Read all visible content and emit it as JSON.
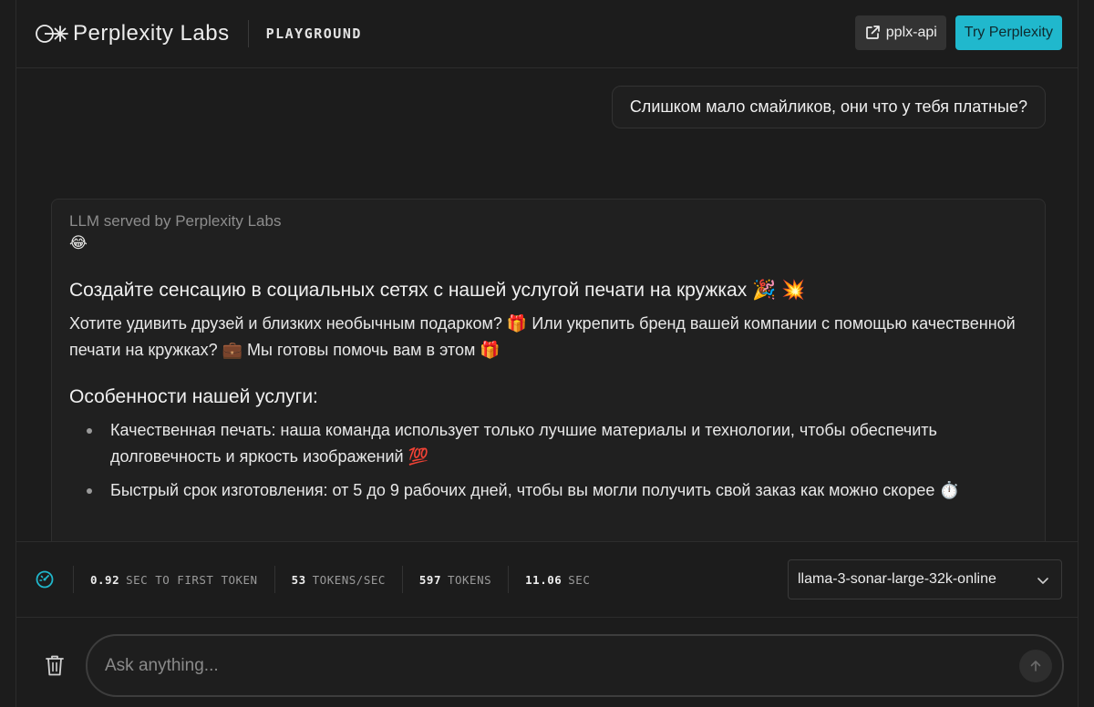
{
  "header": {
    "brand": "Perplexity Labs",
    "section": "PLAYGROUND",
    "api_button": "pplx-api",
    "try_button": "Try Perplexity",
    "accent": "#20b8cd"
  },
  "chat": {
    "user_message": "Слишком мало смайликов, они что у тебя платные?",
    "assistant": {
      "served_by": "LLM served by Perplexity Labs",
      "emoji": "😂",
      "heading": "Создайте сенсацию в социальных сетях с нашей услугой печати на кружках 🎉 💥",
      "paragraph": "Хотите удивить друзей и близких необычным подарком? 🎁 Или укрепить бренд вашей компании с помощью качественной печати на кружках? 💼 Мы готовы помочь вам в этом 🎁",
      "subheading": "Особенности нашей услуги:",
      "items": [
        "Качественная печать: наша команда использует только лучшие материалы и технологии, чтобы обеспечить долговечность и яркость изображений 💯",
        "Быстрый срок изготовления: от 5 до 9 рабочих дней, чтобы вы могли получить свой заказ как можно скорее ⏱️"
      ]
    }
  },
  "stats": {
    "first_token_value": "0.92",
    "first_token_label": "SEC TO FIRST TOKEN",
    "tokens_per_sec_value": "53",
    "tokens_per_sec_label": "TOKENS/SEC",
    "tokens_value": "597",
    "tokens_label": "TOKENS",
    "time_value": "11.06",
    "time_label": "SEC"
  },
  "model": {
    "selected": "llama-3-sonar-large-32k-online"
  },
  "input": {
    "placeholder": "Ask anything..."
  },
  "icons": {
    "logo": "perplexity-logo-icon",
    "external_link": "external-link-icon",
    "speedometer": "speedometer-icon",
    "chevron": "chevron-down-icon",
    "trash": "trash-icon",
    "send": "arrow-up-icon"
  }
}
